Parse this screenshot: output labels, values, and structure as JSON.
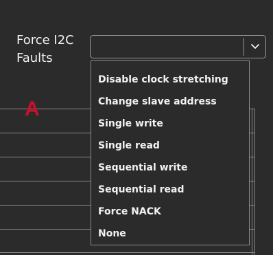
{
  "field": {
    "label": "Force I2C Faults",
    "selected_value": ""
  },
  "marker": {
    "letter": "A",
    "color": "#c8102e"
  },
  "icons": {
    "dropdown_arrow": "chevron-down-icon"
  },
  "colors": {
    "background": "#2b2b2b",
    "text": "#f2f2f2",
    "border": "#9a9a9a"
  },
  "dropdown": {
    "options": [
      "Disable clock stretching",
      "Change slave address",
      "Single write",
      "Single read",
      "Sequential write",
      "Sequential read",
      "Force NACK",
      "None"
    ]
  }
}
